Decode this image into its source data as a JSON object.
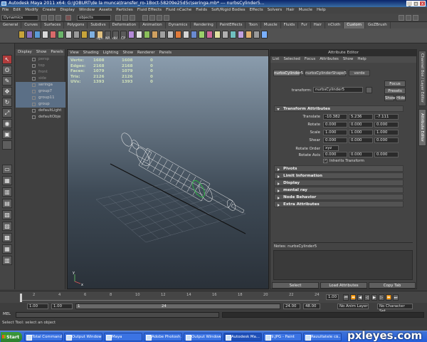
{
  "window": {
    "title": "Autodesk Maya 2011 x64: G:\\JOBURT\\de la munca\\transfer_ro-1Boct-58209e25d5c\\seringa.mb*  ---  nurbsCylinder5..."
  },
  "menubar": [
    "File",
    "Edit",
    "Modify",
    "Create",
    "Display",
    "Window",
    "Assets",
    "Particles",
    "Fluid Effects",
    "Fluid nCache",
    "Fields",
    "Soft/Rigid Bodies",
    "Effects",
    "Solvers",
    "Hair",
    "Muscle",
    "Help"
  ],
  "statusline": {
    "mode": "Dynamics",
    "object_field": "objects"
  },
  "shelf_tabs": [
    "General",
    "Curves",
    "Surfaces",
    "Polygons",
    "Subdivs",
    "Deformation",
    "Animation",
    "Dynamics",
    "Rendering",
    "PaintEffects",
    "Toon",
    "Muscle",
    "Fluids",
    "Fur",
    "Hair",
    "nCloth",
    "Custom",
    "GoZBrush"
  ],
  "shelf_active": "Custom",
  "shelf_labels": {
    "dyn": "dyn",
    "nr": "NR",
    "dbl": "dbl",
    "cp": "CP"
  },
  "outliner": {
    "menu": [
      "Display",
      "Show",
      "Panels"
    ],
    "items": [
      {
        "label": "persp",
        "dim": true,
        "sel": false
      },
      {
        "label": "top",
        "dim": true,
        "sel": false
      },
      {
        "label": "front",
        "dim": true,
        "sel": false
      },
      {
        "label": "side",
        "dim": true,
        "sel": false
      },
      {
        "label": "seringa",
        "dim": false,
        "sel": true
      },
      {
        "label": "group7",
        "dim": false,
        "sel": true
      },
      {
        "label": "group11",
        "dim": false,
        "sel": true
      },
      {
        "label": "group",
        "dim": false,
        "sel": true
      },
      {
        "label": "defaultLight",
        "dim": false,
        "sel": false
      },
      {
        "label": "defaultObje",
        "dim": false,
        "sel": false
      }
    ]
  },
  "viewport": {
    "menu": [
      "View",
      "Shading",
      "Lighting",
      "Show",
      "Renderer",
      "Panels"
    ],
    "hud": [
      {
        "k": "Verts:",
        "a": "1608",
        "b": "1608",
        "c": "0"
      },
      {
        "k": "Edges:",
        "a": "2168",
        "b": "2168",
        "c": "0"
      },
      {
        "k": "Faces:",
        "a": "1079",
        "b": "1079",
        "c": "0"
      },
      {
        "k": "Tris:",
        "a": "2126",
        "b": "2126",
        "c": "0"
      },
      {
        "k": "UVs:",
        "a": "1393",
        "b": "1393",
        "c": "0"
      }
    ],
    "axis": {
      "x": "x",
      "y": "y"
    }
  },
  "attribute_editor": {
    "title": "Attribute Editor",
    "menu": [
      "List",
      "Selected",
      "Focus",
      "Attributes",
      "Show",
      "Help"
    ],
    "tabs": [
      "nurbsCylinder5",
      "nurbsCylinderShape5",
      "verde"
    ],
    "transform_label": "transform:",
    "transform_value": "nurbsCylinder5",
    "focus": "Focus",
    "presets": "Presets",
    "show": "Show",
    "hide": "Hide",
    "section_open": "Transform Attributes",
    "attrs": [
      {
        "label": "Translate",
        "v": [
          "-10.382",
          "5.236",
          "-7.111"
        ]
      },
      {
        "label": "Rotate",
        "v": [
          "0.000",
          "0.000",
          "0.000"
        ]
      },
      {
        "label": "Scale",
        "v": [
          "1.000",
          "1.000",
          "1.000"
        ]
      },
      {
        "label": "Shear",
        "v": [
          "0.000",
          "0.000",
          "0.000"
        ]
      }
    ],
    "rotate_order_label": "Rotate Order",
    "rotate_order_value": "xyz",
    "rotate_axis_label": "Rotate Axis",
    "rotate_axis": [
      "0.000",
      "0.000",
      "0.000"
    ],
    "inherits": "Inherits Transform",
    "sections": [
      "Pivots",
      "Limit Information",
      "Display",
      "mental ray",
      "Node Behavior",
      "Extra Attributes"
    ],
    "notes_label": "Notes: nurbsCylinder5",
    "buttons": [
      "Select",
      "Load Attributes",
      "Copy Tab"
    ]
  },
  "side_tabs": [
    "Channel Box / Layer Editor",
    "Attribute Editor"
  ],
  "timeline": {
    "ticks": [
      "2",
      "4",
      "6",
      "8",
      "10",
      "12",
      "14",
      "16",
      "18",
      "20",
      "22",
      "24"
    ],
    "current_frame": "1.00"
  },
  "range": {
    "start": "1.00",
    "range_start": "1.00",
    "range_inner_start": "1",
    "range_inner_end": "24",
    "end": "24.00",
    "end2": "48.00",
    "anim_layer": "No Anim Layer",
    "char_set": "No Character Set"
  },
  "cmd": {
    "label": "MEL"
  },
  "help": {
    "text": "Select Tool: select an object"
  },
  "taskbar": {
    "start": "Start",
    "tasks": [
      "Total Command...",
      "Output Window",
      "Maya",
      "Adobe Photosh...",
      "Output Window",
      "Autodesk Ma...",
      "9.JPG - Paint",
      "Rezultatele că..."
    ],
    "active_index": 5
  },
  "watermark": "pxleyes.com"
}
